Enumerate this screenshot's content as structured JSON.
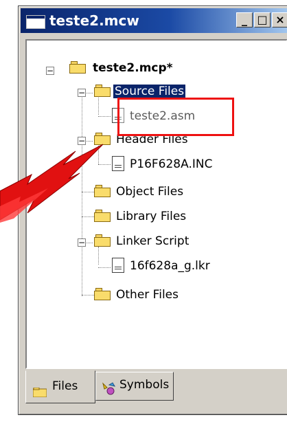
{
  "window": {
    "title": "teste2.mcw",
    "controls": {
      "minimize": "_",
      "maximize": "□",
      "close": "×"
    }
  },
  "tree": {
    "project": "teste2.mcp*",
    "items": [
      {
        "label": "Source Files",
        "type": "folder",
        "expanded": true,
        "selected": true
      },
      {
        "label": "teste2.asm",
        "type": "file-asm"
      },
      {
        "label": "Header Files",
        "type": "folder",
        "expanded": true
      },
      {
        "label": "P16F628A.INC",
        "type": "file"
      },
      {
        "label": "Object Files",
        "type": "folder"
      },
      {
        "label": "Library Files",
        "type": "folder"
      },
      {
        "label": "Linker Script",
        "type": "folder",
        "expanded": true
      },
      {
        "label": "16f628a_g.lkr",
        "type": "file"
      },
      {
        "label": "Other Files",
        "type": "folder"
      }
    ]
  },
  "tabs": [
    {
      "label": "Files",
      "icon": "folder-icon",
      "active": true
    },
    {
      "label": "Symbols",
      "icon": "symbols-icon",
      "active": false
    }
  ],
  "colors": {
    "highlight_border": "#e11111",
    "arrow": "#e11111",
    "selection": "#0a246a"
  }
}
